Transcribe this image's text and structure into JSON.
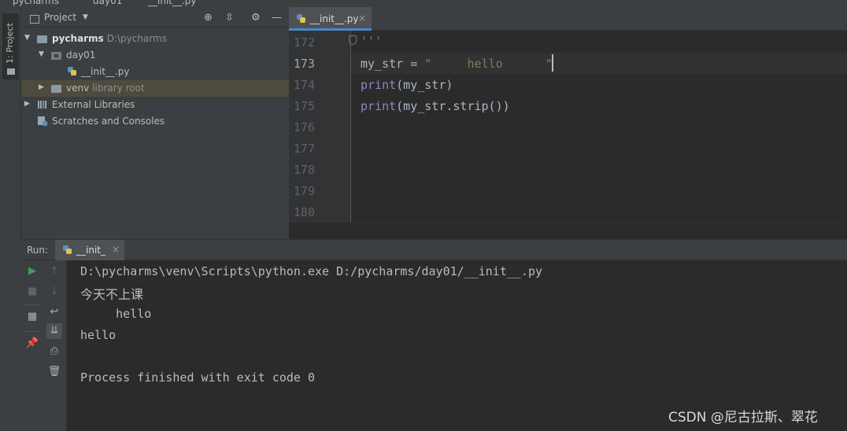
{
  "topbar": {
    "crumbs": [
      "pycharms",
      "day01",
      "__init__.py"
    ]
  },
  "toolstrip": {
    "project_tab_label": "1: Project"
  },
  "project_panel": {
    "title": "Project",
    "header_icons": [
      "crosshair-icon",
      "collapse-icon",
      "gear-icon",
      "minimize-icon"
    ],
    "tree": [
      {
        "label": "pycharms",
        "hint": "D:\\pycharms",
        "expanded": true,
        "type": "folder"
      },
      {
        "label": "day01",
        "hint": "",
        "expanded": true,
        "type": "folder"
      },
      {
        "label": "__init__.py",
        "hint": "",
        "type": "python-file"
      },
      {
        "label": "venv",
        "hint": "library root",
        "expanded": false,
        "type": "folder",
        "selected": true
      },
      {
        "label": "External Libraries",
        "hint": "",
        "expanded": false,
        "type": "library"
      },
      {
        "label": "Scratches and Consoles",
        "hint": "",
        "type": "scratches"
      }
    ]
  },
  "editor": {
    "tab_label": "__init__.py",
    "current_line": 173,
    "lines": [
      {
        "num": "172",
        "code": "'''"
      },
      {
        "num": "173",
        "code": "my_str = \"     hello      \""
      },
      {
        "num": "174",
        "code": "print(my_str)"
      },
      {
        "num": "175",
        "code": "print(my_str.strip())"
      },
      {
        "num": "176",
        "code": ""
      },
      {
        "num": "177",
        "code": ""
      },
      {
        "num": "178",
        "code": ""
      },
      {
        "num": "179",
        "code": ""
      },
      {
        "num": "180",
        "code": ""
      }
    ]
  },
  "run_panel": {
    "label": "Run:",
    "tab_label": "__init_",
    "output": [
      "D:\\pycharms\\venv\\Scripts\\python.exe D:/pycharms/day01/__init__.py",
      "今天不上课",
      "     hello",
      "hello",
      "",
      "Process finished with exit code 0"
    ]
  },
  "watermark": "CSDN @尼古拉斯、翠花",
  "colors": {
    "accent": "#4a88c7",
    "run_green": "#499c54",
    "keyword_fn": "#8888c6",
    "string": "#6a8759",
    "selection": "#4e4b3e"
  }
}
